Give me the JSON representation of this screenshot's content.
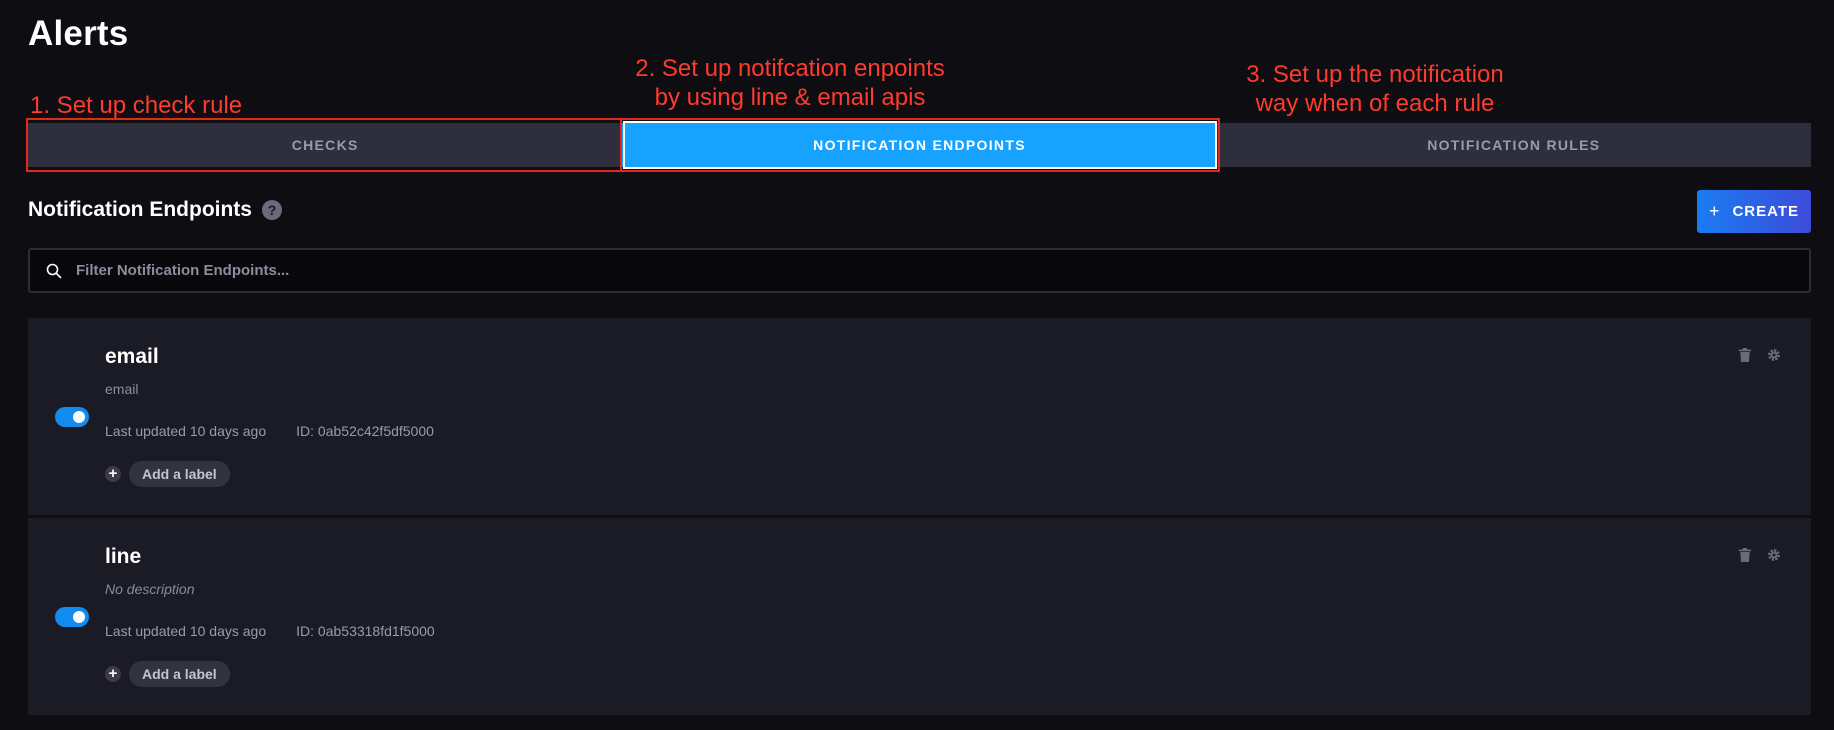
{
  "page": {
    "title": "Alerts"
  },
  "annotations": {
    "step1": "1. Set up check rule",
    "step2": "2. Set up notifcation enpoints\nby using line & email apis",
    "step3": "3. Set up the notification\nway when of each rule",
    "color": "#ff3a2e"
  },
  "tabs": [
    {
      "label": "CHECKS",
      "active": false
    },
    {
      "label": "NOTIFICATION ENDPOINTS",
      "active": true
    },
    {
      "label": "NOTIFICATION RULES",
      "active": false
    }
  ],
  "section": {
    "title": "Notification Endpoints",
    "help_icon": "question-circle-icon",
    "create_label": "CREATE",
    "create_icon": "plus-icon"
  },
  "search": {
    "placeholder": "Filter Notification Endpoints...",
    "value": "",
    "icon": "search-icon"
  },
  "endpoints": [
    {
      "name": "email",
      "description": "email",
      "enabled": true,
      "last_updated": "Last updated 10 days ago",
      "id_text": "ID: 0ab52c42f5df5000",
      "add_label": "Add a label"
    },
    {
      "name": "line",
      "description": "No description",
      "enabled": true,
      "last_updated": "Last updated 10 days ago",
      "id_text": "ID: 0ab53318fd1f5000",
      "add_label": "Add a label"
    }
  ],
  "colors": {
    "accent": "#17a2ff",
    "toggle_on": "#118cee",
    "background": "#0d0d12",
    "card": "#1b1b26"
  }
}
